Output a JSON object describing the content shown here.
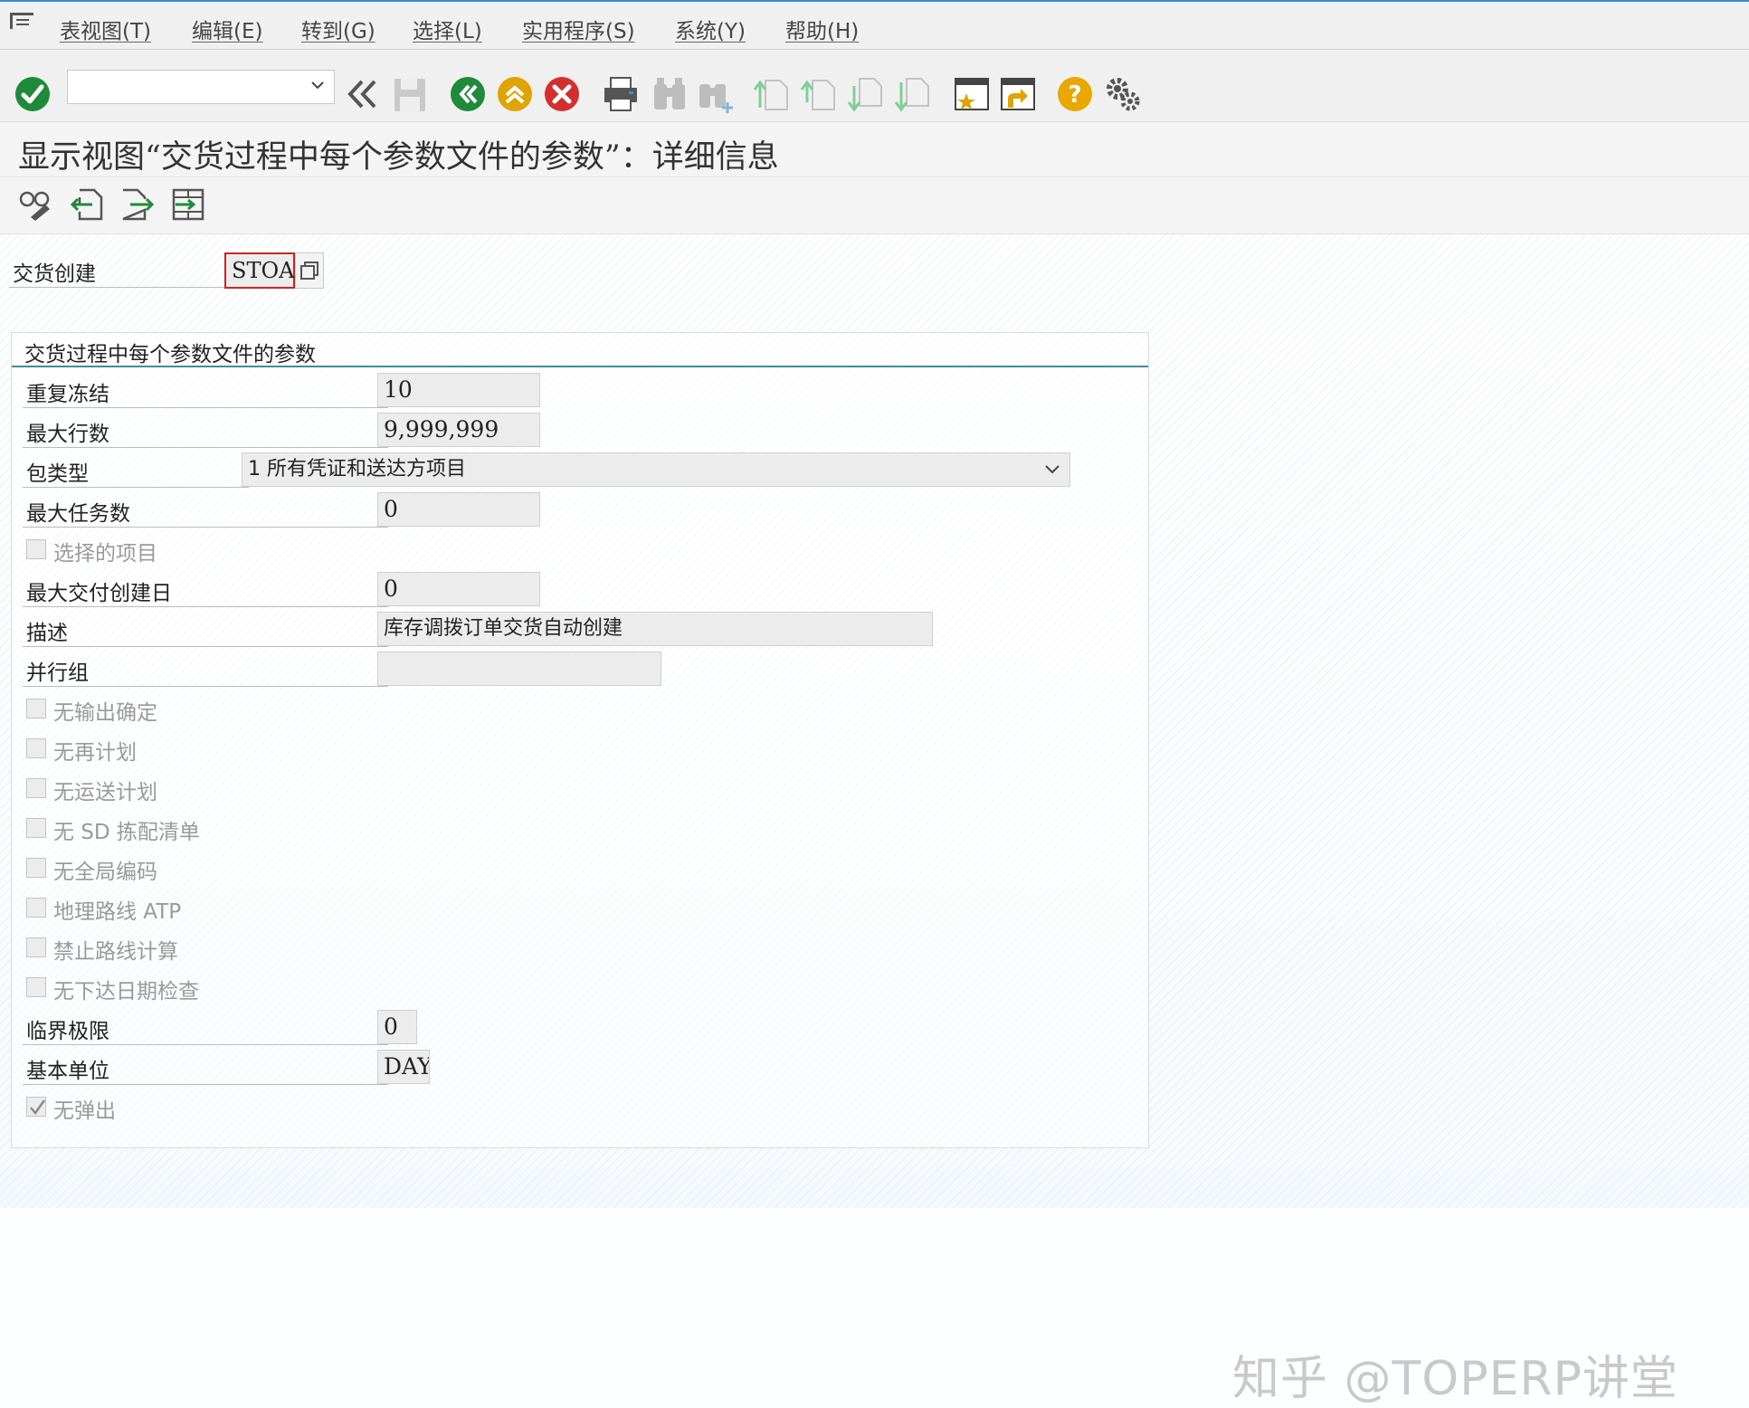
{
  "menu": [
    "表视图(T)",
    "编辑(E)",
    "转到(G)",
    "选择(L)",
    "实用程序(S)",
    "系统(Y)",
    "帮助(H)"
  ],
  "toolbar": {
    "command_value": "",
    "icons": [
      "enter-icon",
      "back-double-icon",
      "save-icon",
      "back-icon",
      "exit-icon",
      "cancel-icon",
      "print-icon",
      "find-icon",
      "find-next-icon",
      "first-page-icon",
      "previous-page-icon",
      "next-page-icon",
      "last-page-icon",
      "create-session-icon",
      "shortcut-icon",
      "help-icon",
      "settings-icon"
    ]
  },
  "title": "显示视图“交货过程中每个参数文件的参数”：详细信息",
  "app_toolbar": [
    "display-change-icon",
    "previous-entry-icon",
    "next-entry-icon",
    "variable-list-icon"
  ],
  "key": {
    "label": "交货创建",
    "value": "STOA"
  },
  "group": {
    "title": "交货过程中每个参数文件的参数",
    "fields": {
      "repeat_freeze": {
        "label": "重复冻结",
        "value": "10"
      },
      "max_rows": {
        "label": "最大行数",
        "value": "9,999,999"
      },
      "package_type": {
        "label": "包类型",
        "value": "1 所有凭证和送达方项目"
      },
      "max_tasks": {
        "label": "最大任务数",
        "value": "0"
      },
      "selected_items": {
        "label": "选择的项目",
        "checked": false
      },
      "max_delivery_days": {
        "label": "最大交付创建日",
        "value": "0"
      },
      "description": {
        "label": "描述",
        "value": "库存调拨订单交货自动创建"
      },
      "parallel_group": {
        "label": "并行组",
        "value": ""
      },
      "no_output": {
        "label": "无输出确定",
        "checked": false
      },
      "no_reschedule": {
        "label": "无再计划",
        "checked": false
      },
      "no_transport_plan": {
        "label": "无运送计划",
        "checked": false
      },
      "no_sd_picklist": {
        "label": "无 SD 拣配清单",
        "checked": false
      },
      "no_global_code": {
        "label": "无全局编码",
        "checked": false
      },
      "geo_route_atp": {
        "label": "地理路线 ATP",
        "checked": false
      },
      "no_route_calc": {
        "label": "禁止路线计算",
        "checked": false
      },
      "no_date_check": {
        "label": "无下达日期检查",
        "checked": false
      },
      "critical_limit": {
        "label": "临界极限",
        "value": "0"
      },
      "base_unit": {
        "label": "基本单位",
        "value": "DAY"
      },
      "no_popup": {
        "label": "无弹出",
        "checked": true
      }
    }
  },
  "watermark": "知乎 @TOPERP讲堂"
}
